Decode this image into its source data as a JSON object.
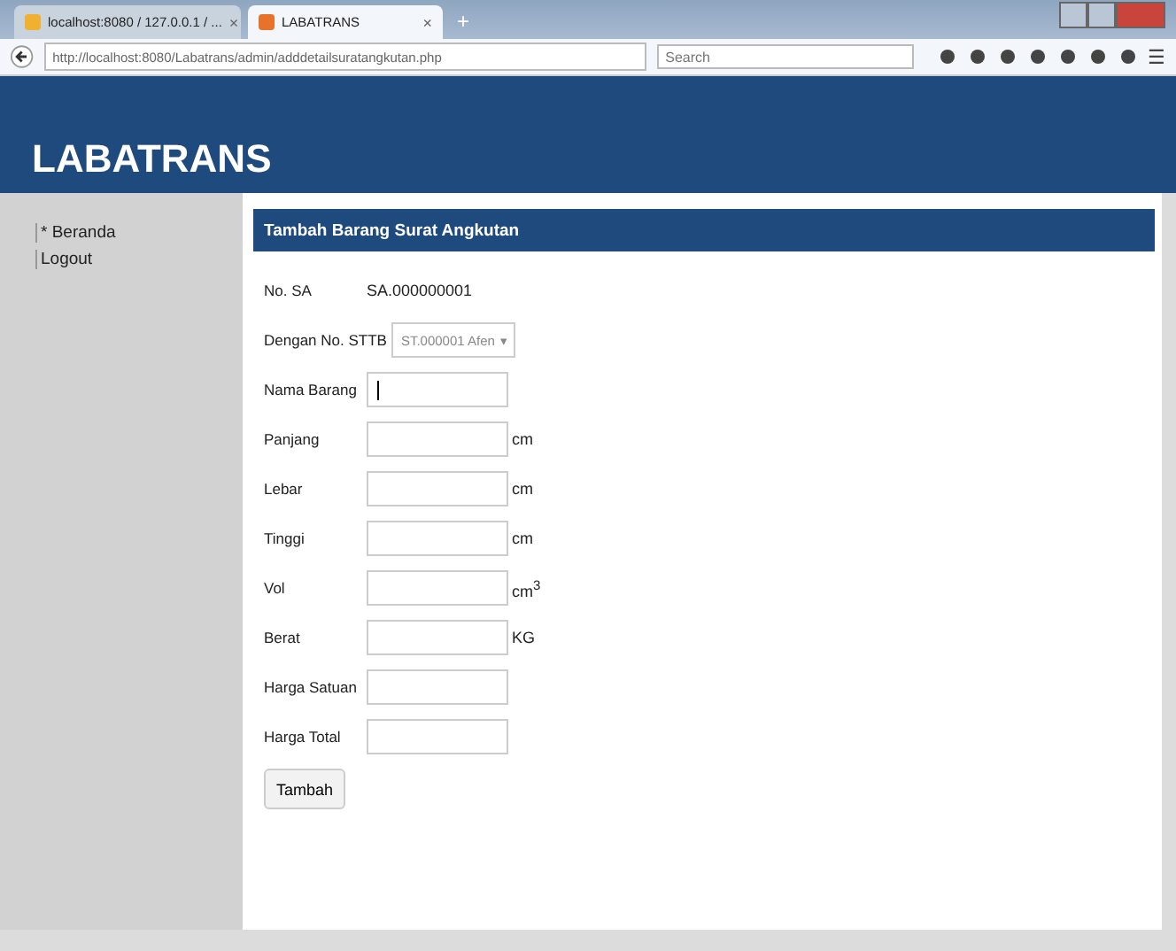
{
  "browser": {
    "tabs": [
      {
        "title": "localhost:8080 / 127.0.0.1 / ...",
        "close": "×",
        "selected": false
      },
      {
        "title": "LABATRANS",
        "close": "×",
        "selected": true
      }
    ],
    "new_tab": "+",
    "url": "http://localhost:8080/Labatrans/admin/adddetailsuratangkutan.php",
    "search": {
      "placeholder": "Search"
    },
    "menu": "☰"
  },
  "header": {
    "title": "LABATRANS"
  },
  "sidebar": {
    "items": [
      {
        "label": "Beranda",
        "bullet": "*"
      },
      {
        "label": "Logout"
      }
    ]
  },
  "form": {
    "title": "Tambah Barang Surat Angkutan",
    "fields": [
      {
        "kind": "text",
        "label": "No. SA",
        "value": "SA.000000001"
      },
      {
        "kind": "select",
        "label": "Dengan No. STTB",
        "value": "ST.000001 Afen",
        "arrow": "▾"
      },
      {
        "kind": "input",
        "label": "Nama Barang",
        "focused": true
      },
      {
        "kind": "input",
        "label": "Panjang",
        "unit": "cm"
      },
      {
        "kind": "input",
        "label": "Lebar",
        "unit": "cm"
      },
      {
        "kind": "input",
        "label": "Tinggi",
        "unit": "cm"
      },
      {
        "kind": "input",
        "label": "Vol",
        "unit": "cm$^{3}$"
      },
      {
        "kind": "input",
        "label": "Berat",
        "unit": "KG"
      },
      {
        "kind": "input",
        "label": "Harga Satuan"
      },
      {
        "kind": "input",
        "label": "Harga Total"
      }
    ],
    "button": "Tambah"
  }
}
